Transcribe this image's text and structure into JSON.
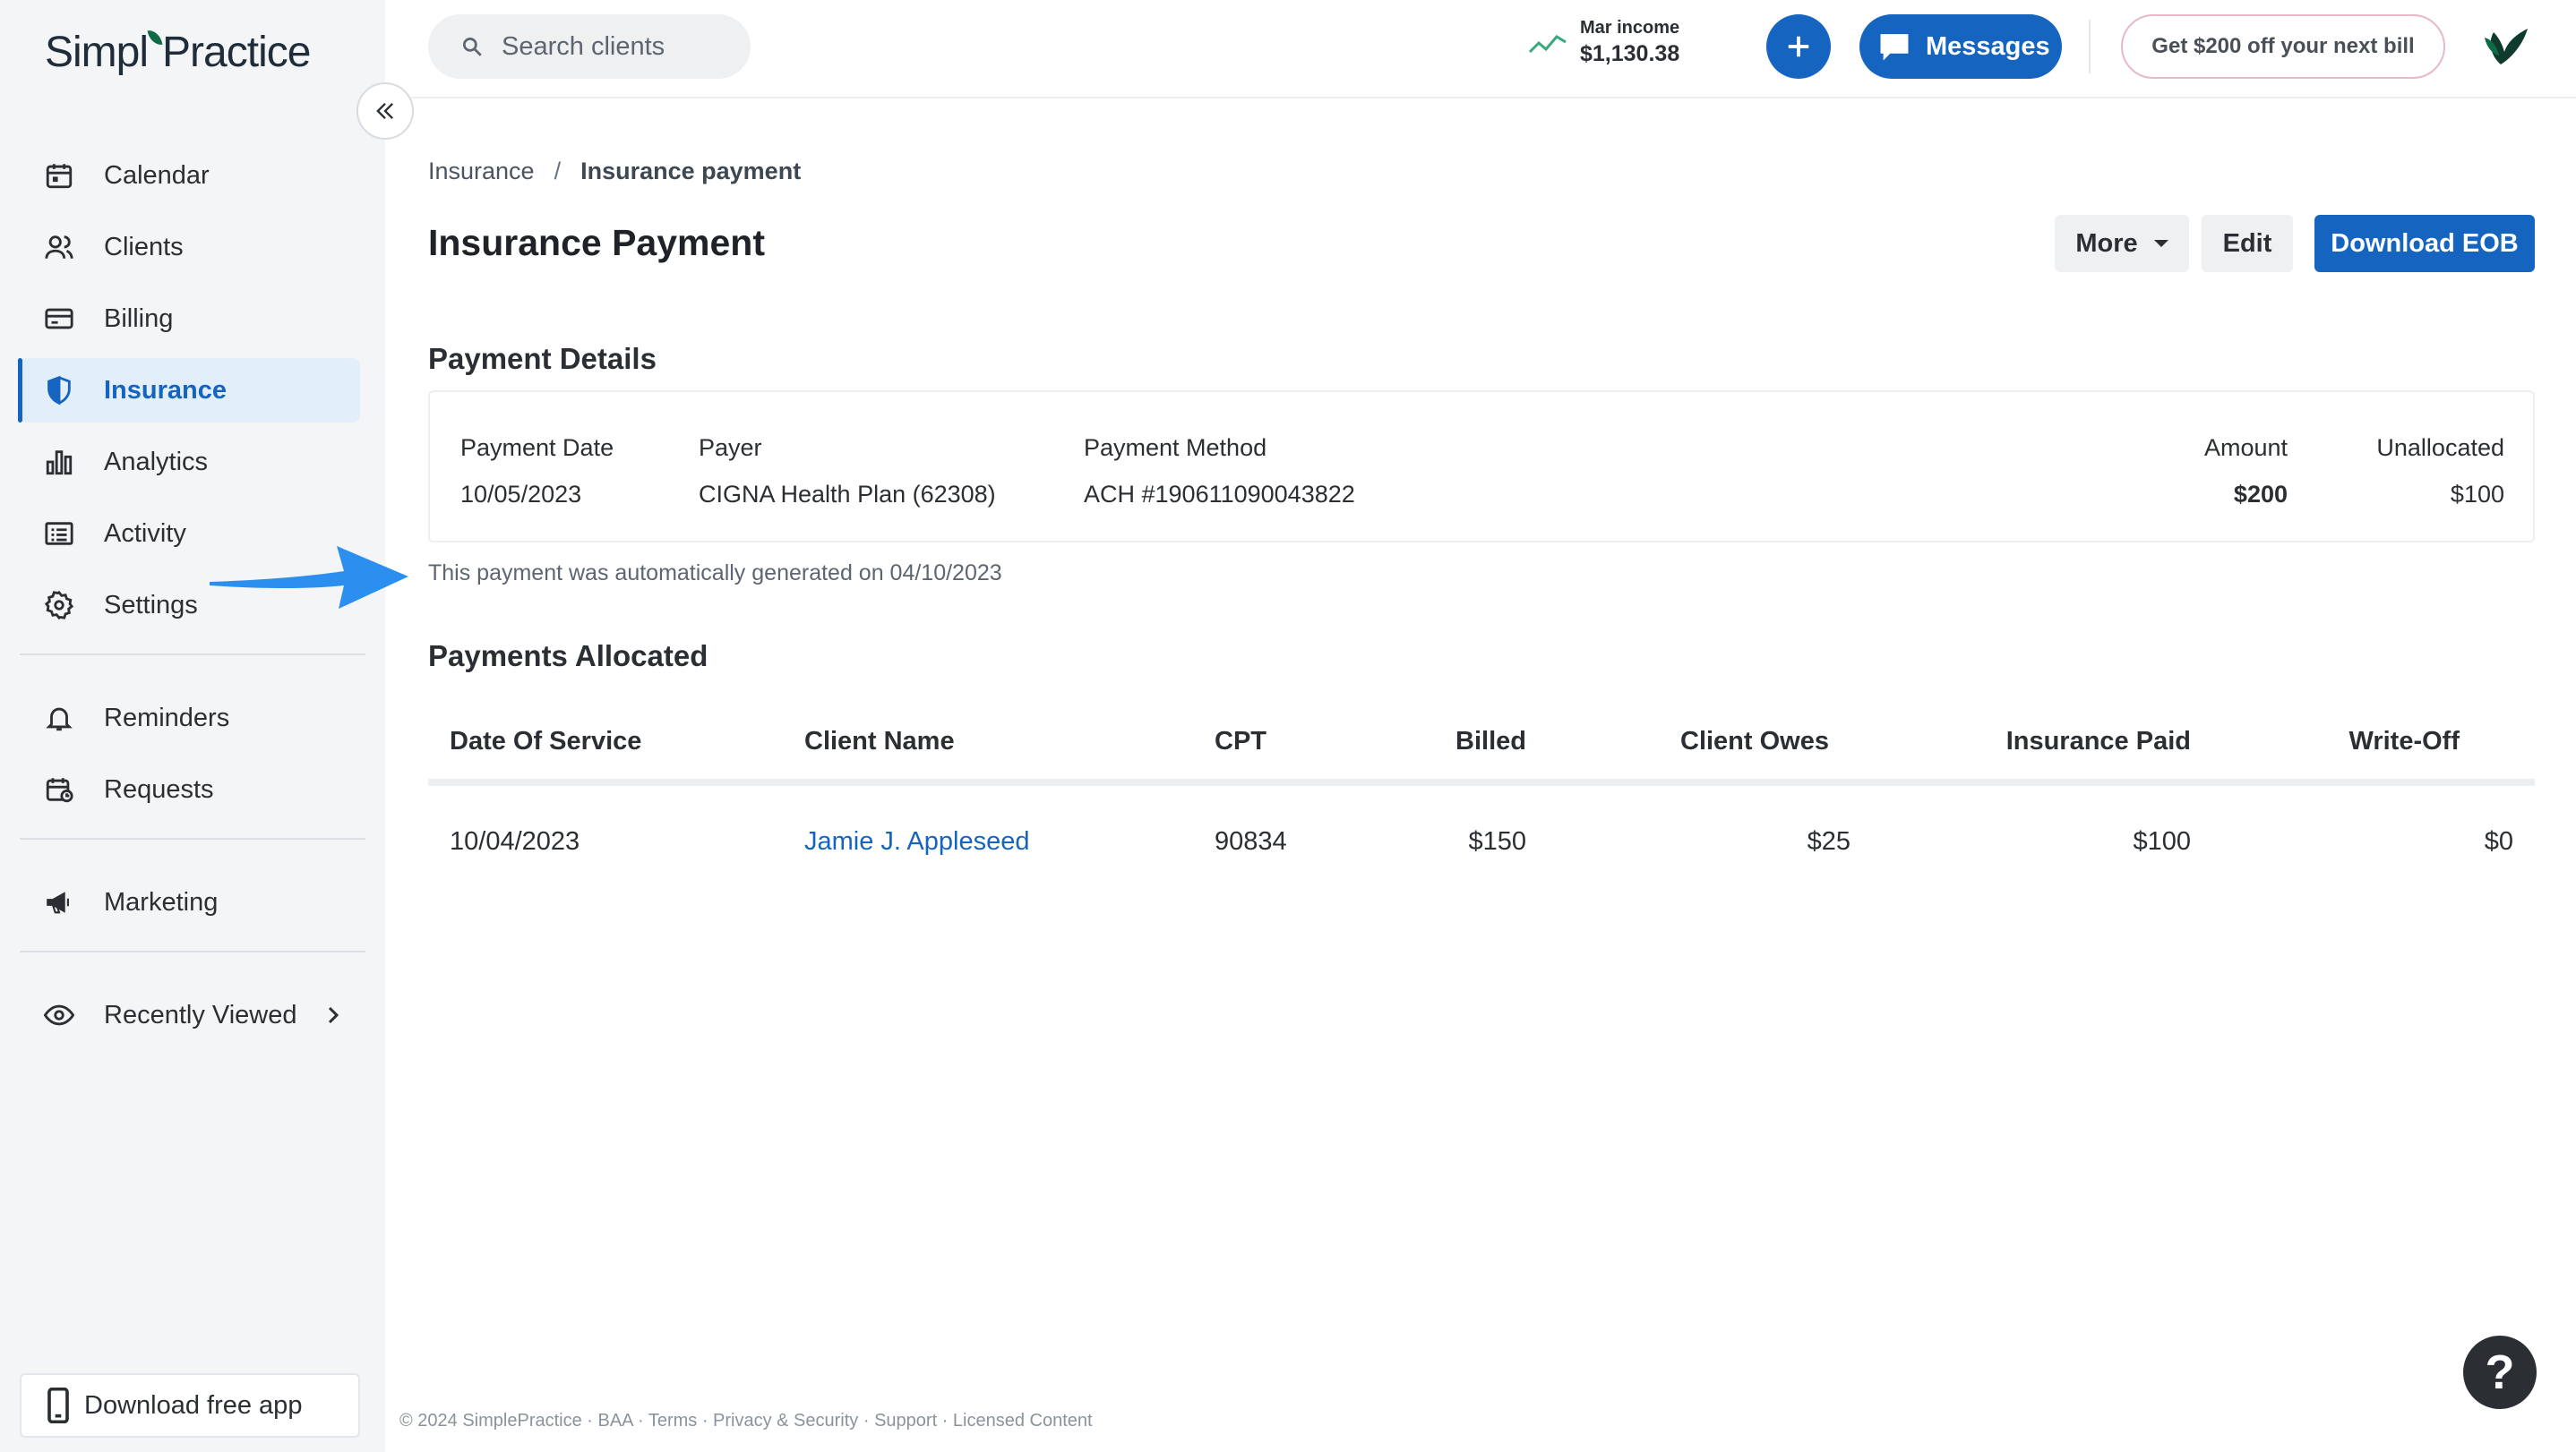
{
  "brand": {
    "logo_text_1": "Simpl",
    "logo_text_2": "Practice",
    "logo_full": "SimplePractice"
  },
  "sidebar": {
    "items": [
      {
        "label": "Calendar",
        "icon": "calendar-icon"
      },
      {
        "label": "Clients",
        "icon": "clients-icon"
      },
      {
        "label": "Billing",
        "icon": "billing-card-icon"
      },
      {
        "label": "Insurance",
        "icon": "shield-icon",
        "active": true
      },
      {
        "label": "Analytics",
        "icon": "bar-chart-icon"
      },
      {
        "label": "Activity",
        "icon": "activity-list-icon"
      },
      {
        "label": "Settings",
        "icon": "gear-icon"
      }
    ],
    "items2": [
      {
        "label": "Reminders",
        "icon": "bell-icon"
      },
      {
        "label": "Requests",
        "icon": "calendar-request-icon"
      }
    ],
    "items3": [
      {
        "label": "Marketing",
        "icon": "megaphone-icon"
      }
    ],
    "recently_viewed": {
      "label": "Recently Viewed",
      "icon": "eye-icon"
    },
    "download_app": {
      "label": "Download free app",
      "icon": "phone-icon"
    }
  },
  "topbar": {
    "search_placeholder": "Search clients",
    "income_label": "Mar income",
    "income_value": "$1,130.38",
    "messages_label": "Messages",
    "promo_label": "Get $200 off your next bill"
  },
  "breadcrumb": {
    "parent": "Insurance",
    "separator": "/",
    "current": "Insurance payment"
  },
  "page_title": "Insurance Payment",
  "actions": {
    "more": "More",
    "edit": "Edit",
    "download_eob": "Download EOB"
  },
  "payment_details": {
    "title": "Payment Details",
    "payment_date_label": "Payment Date",
    "payment_date": "10/05/2023",
    "payer_label": "Payer",
    "payer": "CIGNA Health Plan (62308)",
    "method_label": "Payment Method",
    "method": "ACH #190611090043822",
    "amount_label": "Amount",
    "amount": "$200",
    "unallocated_label": "Unallocated",
    "unallocated": "$100",
    "auto_note": "This payment was automatically generated on 04/10/2023"
  },
  "payments_allocated": {
    "title": "Payments Allocated",
    "columns": [
      "Date Of Service",
      "Client Name",
      "CPT",
      "Billed",
      "Client Owes",
      "Insurance Paid",
      "Write-Off"
    ],
    "rows": [
      {
        "date": "10/04/2023",
        "client": "Jamie J. Appleseed",
        "cpt": "90834",
        "billed": "$150",
        "client_owes": "$25",
        "insurance_paid": "$100",
        "write_off": "$0"
      }
    ]
  },
  "footer": "© 2024 SimplePractice · BAA · Terms · Privacy & Security · Support · Licensed Content",
  "help": {
    "label": "?"
  },
  "colors": {
    "primary": "#1565c0",
    "sidebar_bg": "#f4f5f6",
    "active_bg": "#e3eefb",
    "arrow": "#2b8ff0",
    "brand_green": "#0e6b46"
  }
}
